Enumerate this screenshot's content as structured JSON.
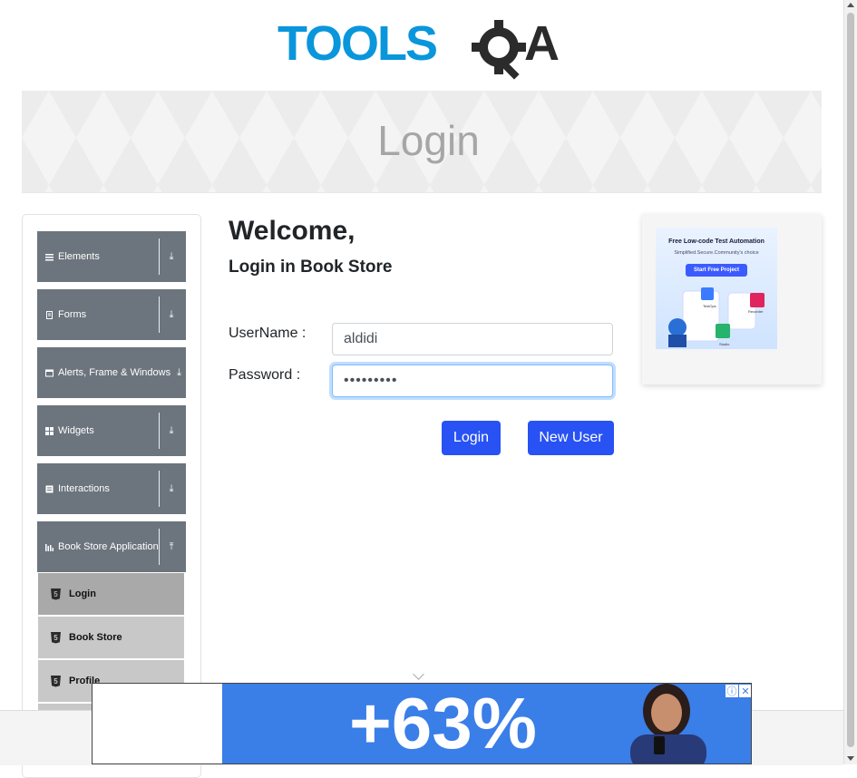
{
  "brand": {
    "logo_text": "TOOLSQA"
  },
  "banner": {
    "title": "Login"
  },
  "sidebar": {
    "groups": [
      {
        "label": "Elements",
        "icon": "hamburger-icon",
        "arrow": "⤓"
      },
      {
        "label": "Forms",
        "icon": "document-icon",
        "arrow": "⤓"
      },
      {
        "label": "Alerts, Frame & Windows",
        "icon": "window-icon",
        "arrow": "⤓"
      },
      {
        "label": "Widgets",
        "icon": "grid-icon",
        "arrow": "⤓"
      },
      {
        "label": "Interactions",
        "icon": "interaction-icon",
        "arrow": "⤓"
      },
      {
        "label": "Book Store Application",
        "icon": "books-icon",
        "arrow": "⤒"
      }
    ],
    "subitems": [
      {
        "label": "Login",
        "icon": "html5-icon",
        "active": true
      },
      {
        "label": "Book Store",
        "icon": "html5-icon",
        "active": false
      },
      {
        "label": "Profile",
        "icon": "html5-icon",
        "active": false
      }
    ]
  },
  "main": {
    "heading": "Welcome,",
    "subheading": "Login in Book Store",
    "username_label": "UserName :",
    "username_value": "aldidi",
    "password_label": "Password :",
    "password_value": "•••••••••",
    "login_button": "Login",
    "new_user_button": "New User"
  },
  "side_ad": {
    "headline": "Free Low-code Test Automation",
    "tagline": "Simplified.Secure.Community's choice",
    "cta": "Start Free Project",
    "products": [
      "TestOps",
      "Recorder",
      "Studio"
    ]
  },
  "bottom_ad": {
    "text": "+63%",
    "info_icon": "info-icon",
    "close_icon": "close-icon"
  },
  "colors": {
    "primary": "#2852f4",
    "sidebar_group": "#6c757d",
    "sub_active": "#a9a9a9",
    "sub_inactive": "#c8c8c8"
  }
}
